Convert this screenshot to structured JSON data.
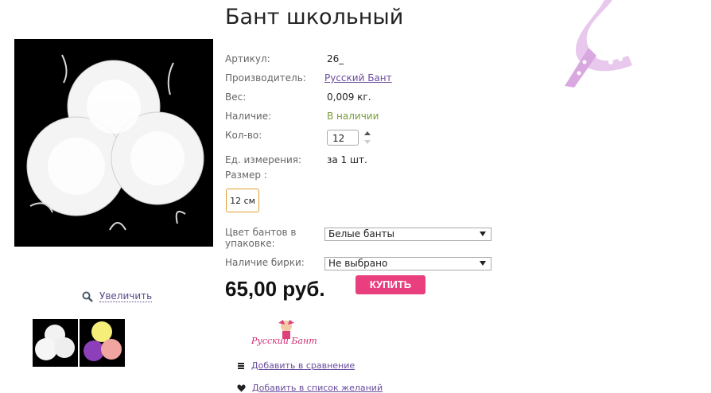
{
  "product": {
    "title": "Бант школьный",
    "zoom_label": "Увеличить"
  },
  "specs": {
    "sku_label": "Артикул:",
    "sku_value": "26_",
    "maker_label": "Производитель:",
    "maker_value": "Русский Бант",
    "weight_label": "Вес:",
    "weight_value": "0,009 кг.",
    "stock_label": "Наличие:",
    "stock_value": "В наличии",
    "qty_label": "Кол-во:",
    "qty_value": "12",
    "unit_label": "Ед. измерения:",
    "unit_value": "за 1 шт.",
    "size_label": "Размер :",
    "size_option": "12 см",
    "color_label": "Цвет бантов в упаковке:",
    "color_value": "Белые банты",
    "tag_label": "Наличие бирки:",
    "tag_value": "Не выбрано"
  },
  "purchase": {
    "price": "65,00 руб.",
    "buy_label": "КУПИТЬ"
  },
  "brand": {
    "logo_text": "Русский Бант"
  },
  "actions": {
    "compare": "Добавить в сравнение",
    "wishlist": "Добавить в список желаний"
  },
  "colors": {
    "buy_button": "#ea3f7e",
    "link": "#6a4c9c",
    "in_stock": "#7a9a3a",
    "size_selected_border": "#e0a030"
  },
  "icons": [
    "search-icon",
    "list-icon",
    "heart-icon",
    "ribbon-decoration"
  ]
}
